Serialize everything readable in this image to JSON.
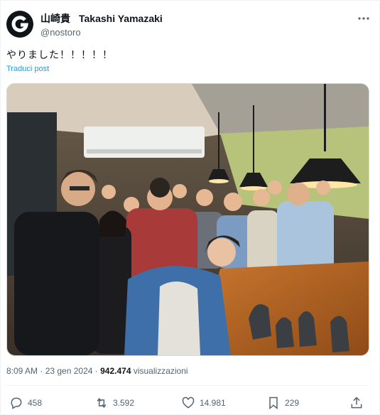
{
  "author": {
    "display_name": "山崎貴",
    "english_name": "Takashi Yamazaki",
    "handle": "@nostoro",
    "avatar_icon": "g-logo-icon"
  },
  "tweet": {
    "text": "やりました！！！！！",
    "translate_label": "Traduci post",
    "image_icon": "group-photo"
  },
  "meta": {
    "time": "8:09 AM",
    "separator": " · ",
    "date": "23 gen 2024",
    "views": "942.474",
    "views_label": "visualizzazioni"
  },
  "actions": {
    "replies": "458",
    "reposts": "3.592",
    "likes": "14.981",
    "bookmarks": "229"
  },
  "colors": {
    "accent": "#1d9bf0",
    "secondary_text": "#536471",
    "primary_text": "#0f1419"
  }
}
